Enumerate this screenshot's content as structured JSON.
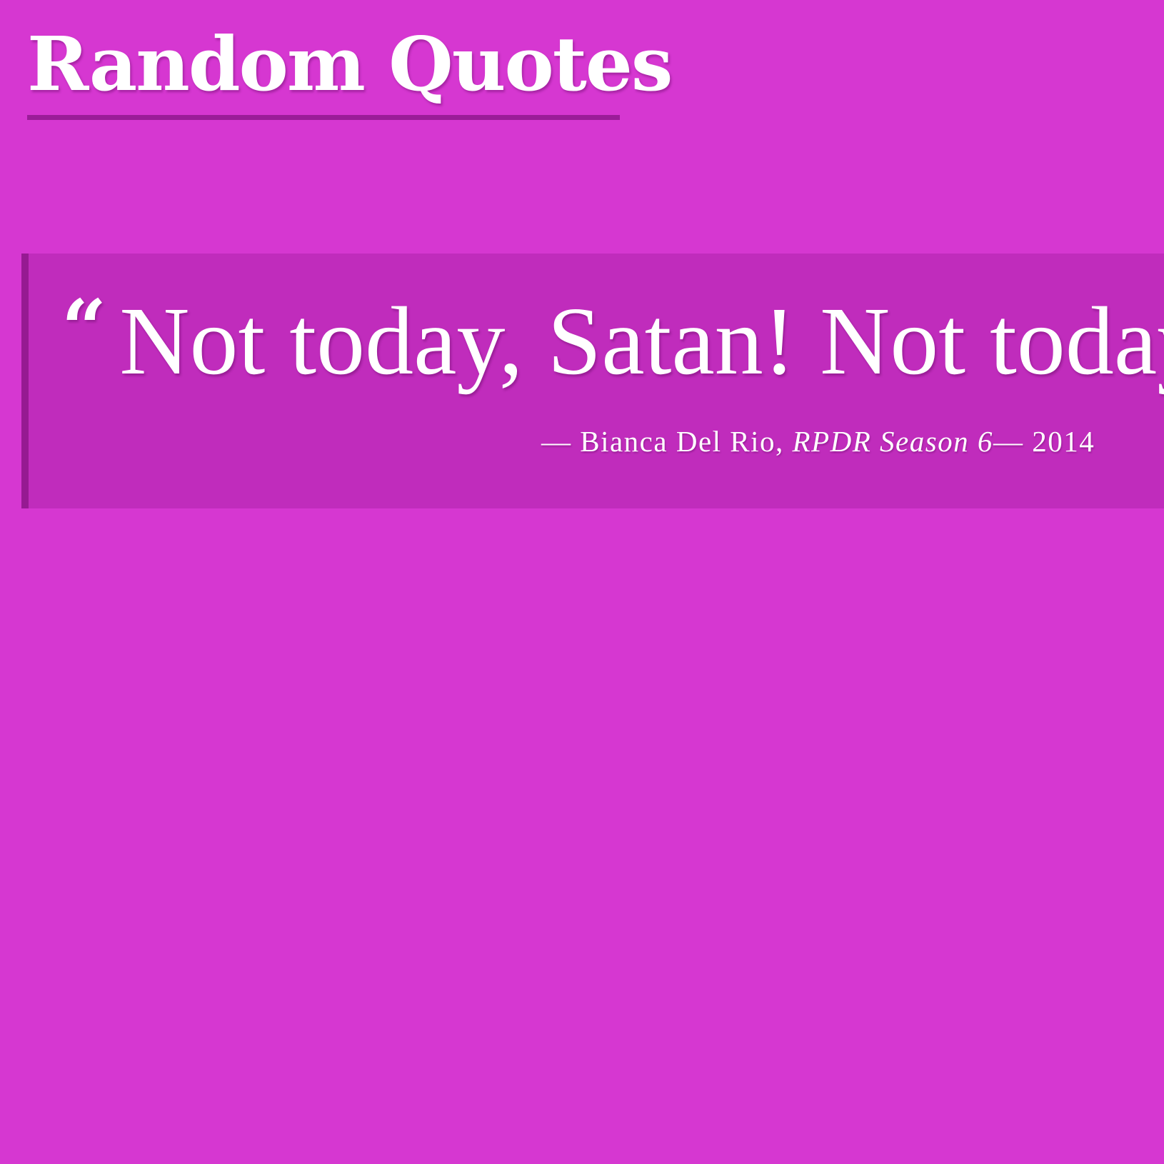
{
  "page": {
    "title": "Random Quotes",
    "background_color": "#d637d1",
    "card_color": "#c02cbc",
    "accent_color": "#961a92"
  },
  "quote": {
    "open_mark": "“",
    "text": "Not today, Satan! Not today.",
    "attribution": {
      "dash": "— ",
      "author": "Bianca Del Rio",
      "separator": ", ",
      "source": "RPDR Season 6",
      "year_prefix": "— ",
      "year": "2014"
    }
  }
}
